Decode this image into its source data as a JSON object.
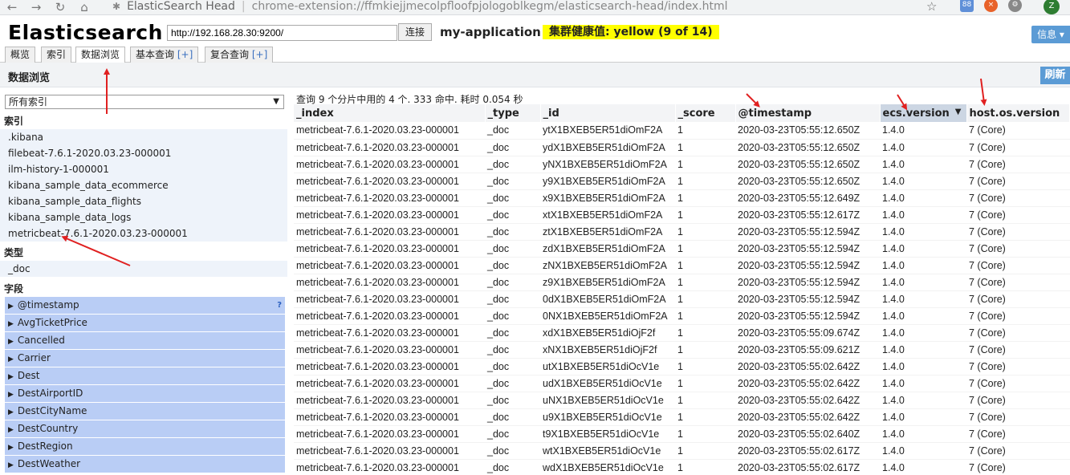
{
  "browser": {
    "tab_title": "ElasticSearch Head",
    "url": "chrome-extension://ffmkiejjmecolpfloofpjologoblkegm/elasticsearch-head/index.html",
    "badge": "88",
    "avatar_letter": "Z"
  },
  "header": {
    "logo": "Elasticsearch",
    "url_value": "http://192.168.28.30:9200/",
    "connect_label": "连接",
    "cluster_name": "my-application",
    "health": "集群健康值: yellow (9 of 14)",
    "info_label": "信息 ▾"
  },
  "tabs": [
    {
      "label": "概览"
    },
    {
      "label": "索引"
    },
    {
      "label": "数据浏览"
    },
    {
      "label": "基本查询",
      "plus": "[+]"
    },
    {
      "label": "复合查询",
      "plus": "[+]"
    }
  ],
  "section": {
    "title": "数据浏览",
    "refresh_label": "刷新"
  },
  "sidebar": {
    "select_value": "所有索引",
    "index_label": "索引",
    "indices": [
      ".kibana",
      "filebeat-7.6.1-2020.03.23-000001",
      "ilm-history-1-000001",
      "kibana_sample_data_ecommerce",
      "kibana_sample_data_flights",
      "kibana_sample_data_logs",
      "metricbeat-7.6.1-2020.03.23-000001"
    ],
    "type_label": "类型",
    "types": [
      "_doc"
    ],
    "field_label": "字段",
    "fields": [
      "@timestamp",
      "AvgTicketPrice",
      "Cancelled",
      "Carrier",
      "Dest",
      "DestAirportID",
      "DestCityName",
      "DestCountry",
      "DestRegion",
      "DestWeather"
    ]
  },
  "results": {
    "info": "查询 9 个分片中用的 4 个. 333 命中. 耗时 0.054 秒",
    "columns": [
      "_index",
      "_type",
      "_id",
      "_score",
      "@timestamp",
      "ecs.version",
      "host.os.version"
    ],
    "rows": [
      [
        "metricbeat-7.6.1-2020.03.23-000001",
        "_doc",
        "ytX1BXEB5ER51diOmF2A",
        "1",
        "2020-03-23T05:55:12.650Z",
        "1.4.0",
        "7 (Core)"
      ],
      [
        "metricbeat-7.6.1-2020.03.23-000001",
        "_doc",
        "ydX1BXEB5ER51diOmF2A",
        "1",
        "2020-03-23T05:55:12.650Z",
        "1.4.0",
        "7 (Core)"
      ],
      [
        "metricbeat-7.6.1-2020.03.23-000001",
        "_doc",
        "yNX1BXEB5ER51diOmF2A",
        "1",
        "2020-03-23T05:55:12.650Z",
        "1.4.0",
        "7 (Core)"
      ],
      [
        "metricbeat-7.6.1-2020.03.23-000001",
        "_doc",
        "y9X1BXEB5ER51diOmF2A",
        "1",
        "2020-03-23T05:55:12.650Z",
        "1.4.0",
        "7 (Core)"
      ],
      [
        "metricbeat-7.6.1-2020.03.23-000001",
        "_doc",
        "x9X1BXEB5ER51diOmF2A",
        "1",
        "2020-03-23T05:55:12.649Z",
        "1.4.0",
        "7 (Core)"
      ],
      [
        "metricbeat-7.6.1-2020.03.23-000001",
        "_doc",
        "xtX1BXEB5ER51diOmF2A",
        "1",
        "2020-03-23T05:55:12.617Z",
        "1.4.0",
        "7 (Core)"
      ],
      [
        "metricbeat-7.6.1-2020.03.23-000001",
        "_doc",
        "ztX1BXEB5ER51diOmF2A",
        "1",
        "2020-03-23T05:55:12.594Z",
        "1.4.0",
        "7 (Core)"
      ],
      [
        "metricbeat-7.6.1-2020.03.23-000001",
        "_doc",
        "zdX1BXEB5ER51diOmF2A",
        "1",
        "2020-03-23T05:55:12.594Z",
        "1.4.0",
        "7 (Core)"
      ],
      [
        "metricbeat-7.6.1-2020.03.23-000001",
        "_doc",
        "zNX1BXEB5ER51diOmF2A",
        "1",
        "2020-03-23T05:55:12.594Z",
        "1.4.0",
        "7 (Core)"
      ],
      [
        "metricbeat-7.6.1-2020.03.23-000001",
        "_doc",
        "z9X1BXEB5ER51diOmF2A",
        "1",
        "2020-03-23T05:55:12.594Z",
        "1.4.0",
        "7 (Core)"
      ],
      [
        "metricbeat-7.6.1-2020.03.23-000001",
        "_doc",
        "0dX1BXEB5ER51diOmF2A",
        "1",
        "2020-03-23T05:55:12.594Z",
        "1.4.0",
        "7 (Core)"
      ],
      [
        "metricbeat-7.6.1-2020.03.23-000001",
        "_doc",
        "0NX1BXEB5ER51diOmF2A",
        "1",
        "2020-03-23T05:55:12.594Z",
        "1.4.0",
        "7 (Core)"
      ],
      [
        "metricbeat-7.6.1-2020.03.23-000001",
        "_doc",
        "xdX1BXEB5ER51diOjF2f",
        "1",
        "2020-03-23T05:55:09.674Z",
        "1.4.0",
        "7 (Core)"
      ],
      [
        "metricbeat-7.6.1-2020.03.23-000001",
        "_doc",
        "xNX1BXEB5ER51diOjF2f",
        "1",
        "2020-03-23T05:55:09.621Z",
        "1.4.0",
        "7 (Core)"
      ],
      [
        "metricbeat-7.6.1-2020.03.23-000001",
        "_doc",
        "utX1BXEB5ER51diOcV1e",
        "1",
        "2020-03-23T05:55:02.642Z",
        "1.4.0",
        "7 (Core)"
      ],
      [
        "metricbeat-7.6.1-2020.03.23-000001",
        "_doc",
        "udX1BXEB5ER51diOcV1e",
        "1",
        "2020-03-23T05:55:02.642Z",
        "1.4.0",
        "7 (Core)"
      ],
      [
        "metricbeat-7.6.1-2020.03.23-000001",
        "_doc",
        "uNX1BXEB5ER51diOcV1e",
        "1",
        "2020-03-23T05:55:02.642Z",
        "1.4.0",
        "7 (Core)"
      ],
      [
        "metricbeat-7.6.1-2020.03.23-000001",
        "_doc",
        "u9X1BXEB5ER51diOcV1e",
        "1",
        "2020-03-23T05:55:02.642Z",
        "1.4.0",
        "7 (Core)"
      ],
      [
        "metricbeat-7.6.1-2020.03.23-000001",
        "_doc",
        "t9X1BXEB5ER51diOcV1e",
        "1",
        "2020-03-23T05:55:02.640Z",
        "1.4.0",
        "7 (Core)"
      ],
      [
        "metricbeat-7.6.1-2020.03.23-000001",
        "_doc",
        "wtX1BXEB5ER51diOcV1e",
        "1",
        "2020-03-23T05:55:02.617Z",
        "1.4.0",
        "7 (Core)"
      ],
      [
        "metricbeat-7.6.1-2020.03.23-000001",
        "_doc",
        "wdX1BXEB5ER51diOcV1e",
        "1",
        "2020-03-23T05:55:02.617Z",
        "1.4.0",
        "7 (Core)"
      ]
    ]
  },
  "colors": {
    "health_bg": "#ffff00",
    "accent_blue": "#5b9bd5",
    "field_bg": "#b9cdf5",
    "annotation_red": "#e02020"
  }
}
